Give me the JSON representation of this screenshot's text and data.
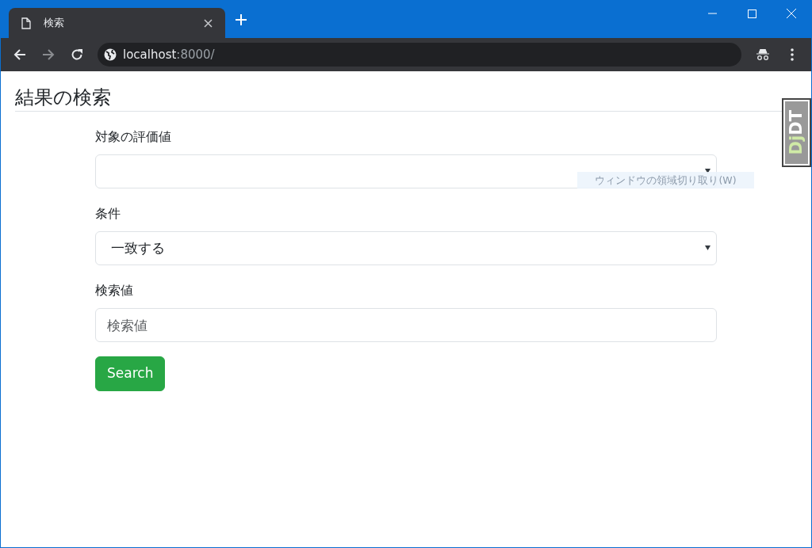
{
  "browser": {
    "tab": {
      "title": "検索"
    },
    "address": {
      "host": "localhost",
      "rest": ":8000/"
    }
  },
  "page": {
    "heading": "結果の検索",
    "fields": [
      {
        "kind": "select",
        "label": "対象の評価値"
      },
      {
        "kind": "select",
        "label": "条件",
        "value": "一致する"
      },
      {
        "kind": "text",
        "label": "検索値",
        "placeholder": "検索値"
      }
    ],
    "button": "Search"
  },
  "tooltip": "ウィンドウの領域切り取り(W)",
  "debug_toolbar": {
    "part_1": "Dj",
    "part_2": "DT"
  }
}
